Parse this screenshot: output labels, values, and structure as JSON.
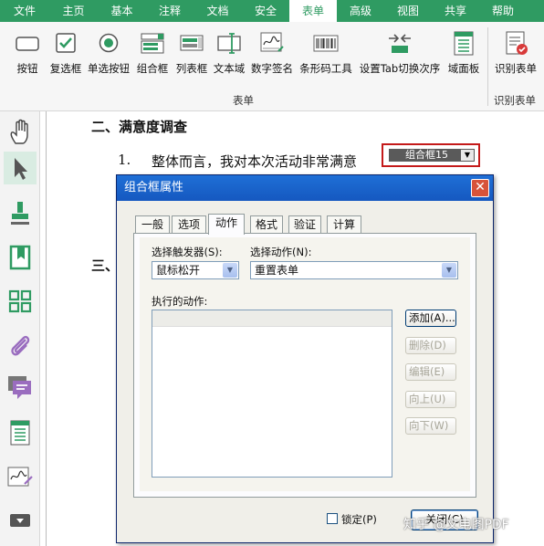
{
  "menu": {
    "tabs": [
      "文件",
      "主页",
      "基本",
      "注释",
      "文档",
      "安全",
      "表单",
      "高级",
      "视图",
      "共享",
      "帮助"
    ],
    "active": "表单"
  },
  "ribbon": {
    "tools": [
      {
        "label": "按钮",
        "icon": "button-icon"
      },
      {
        "label": "复选框",
        "icon": "checkbox-icon"
      },
      {
        "label": "单选按钮",
        "icon": "radio-button-icon"
      },
      {
        "label": "组合框",
        "icon": "combo-box-icon"
      },
      {
        "label": "列表框",
        "icon": "list-box-icon"
      },
      {
        "label": "文本域",
        "icon": "text-field-icon"
      },
      {
        "label": "数字签名",
        "icon": "digital-signature-icon"
      },
      {
        "label": "条形码工具",
        "icon": "barcode-icon"
      },
      {
        "label": "设置Tab切换次序",
        "icon": "tab-order-icon"
      },
      {
        "label": "域面板",
        "icon": "field-panel-icon"
      }
    ],
    "group_label": "表单",
    "recognize": {
      "label": "识别表单",
      "group_label": "识别表单",
      "icon": "recognize-form-icon"
    }
  },
  "left_toolbar": [
    "hand-icon",
    "select-arrow-icon",
    "stamp-icon",
    "bookmark-icon",
    "thumbnails-icon",
    "attachment-icon",
    "comment-icon",
    "form-fields-icon",
    "signature-icon",
    "more-icon"
  ],
  "document": {
    "heading_2": "二、满意度调查",
    "item_number": "1.",
    "item_text": "整体而言，我对本次活动非常满意",
    "combo_field_label": "组合框15",
    "heading_3_partial": "三、"
  },
  "dialog": {
    "title": "组合框属性",
    "tabs": [
      "一般",
      "选项",
      "动作",
      "格式",
      "验证",
      "计算"
    ],
    "active_tab": "动作",
    "trigger_label": "选择触发器(S):",
    "trigger_value": "鼠标松开",
    "action_label": "选择动作(N):",
    "action_value": "重置表单",
    "executed_label": "执行的动作:",
    "buttons": {
      "add": "添加(A)...",
      "delete": "删除(D)",
      "edit": "编辑(E)",
      "up": "向上(U)",
      "down": "向下(W)"
    },
    "lock_label": "锁定(P)",
    "close_label": "关闭(C)"
  },
  "watermark": "知乎 @文电图PDF",
  "colors": {
    "brand_green": "#2f9b62",
    "dialog_title_blue": "#1f6fd6",
    "field_highlight_red": "#c41a1a"
  }
}
